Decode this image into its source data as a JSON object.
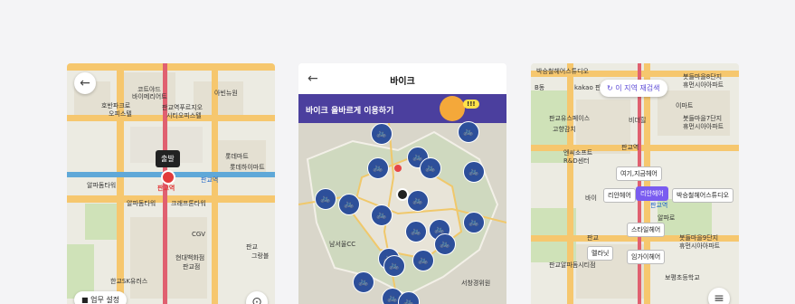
{
  "screen1": {
    "back_icon": "arrow-left-icon",
    "poi": [
      "코트야드",
      "바이메리어트",
      "아빈뉴원",
      "호반파크로",
      "오피스텔",
      "판교역푸르지오",
      "시티오피스텔",
      "롯데마트",
      "롯데하이마트",
      "알파돔타워",
      "크래프톤타워",
      "알파돔타워",
      "CGV",
      "현대백화점",
      "판교점",
      "한교SK유러스",
      "판교",
      "판교역",
      "그랑블"
    ],
    "departure_label": "출발",
    "station_label": "판교역",
    "work_setting_label": "업무 설정",
    "locate_icon": "locate-icon"
  },
  "screen2": {
    "back_icon": "arrow-left-icon",
    "title": "바이크",
    "banner_text": "바이크 올바르게 이용하기",
    "banner_badge": "!!!",
    "map_labels": [
      "남서울CC",
      "서창경위원"
    ],
    "bike_count": 20
  },
  "screen3": {
    "research_chip": "이 지역 재검색",
    "poi": [
      "박승철헤어스튜디오",
      "B동",
      "kakao 판교",
      "봇들마을8단지",
      "휴먼시아아파트",
      "판교유스페이스",
      "고향감치",
      "이마트",
      "비더힐",
      "봇들마을7단지",
      "휴먼시아아파트",
      "엔씨소프트",
      "R&D센터",
      "판교역",
      "바이",
      "판교역",
      "알파로",
      "판교",
      "판교알파돔시티점",
      "봇들마을9단지",
      "휴먼시아아파트",
      "보평초등학교"
    ],
    "place_tags": [
      "여기,지금헤어",
      "리안헤어",
      "박승철헤어스튜디오",
      "스타일헤어",
      "멜라닛",
      "임가이헤어"
    ],
    "selected_tag": "리안헤어",
    "filter_icon": "filter-icon"
  }
}
